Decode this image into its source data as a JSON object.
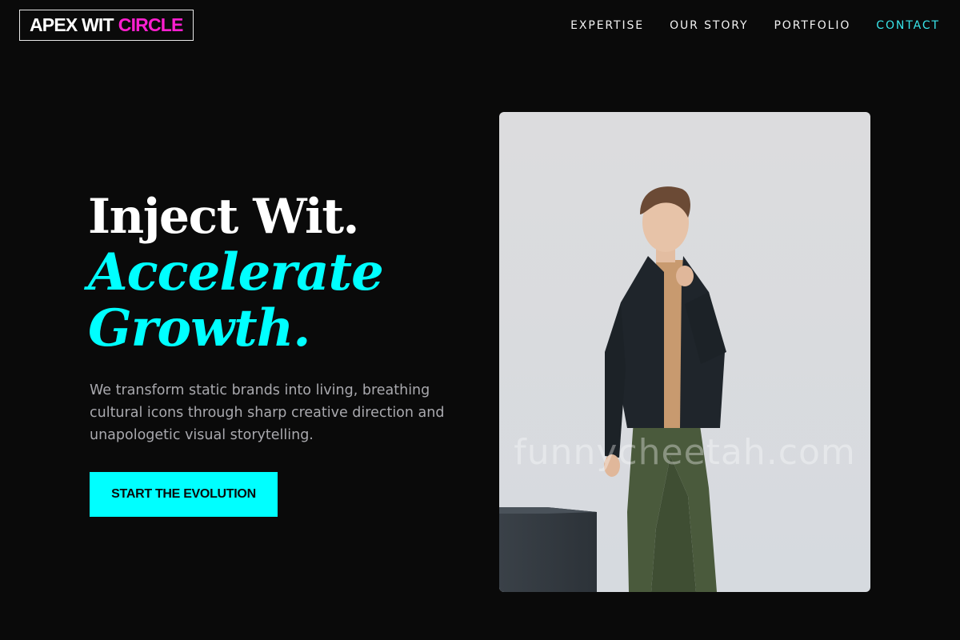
{
  "brand": {
    "word1": "APEX WIT",
    "word2": "CIRCLE",
    "accent_color": "#ff1fd0"
  },
  "nav": {
    "items": [
      {
        "label": "EXPERTISE"
      },
      {
        "label": "OUR STORY"
      },
      {
        "label": "PORTFOLIO"
      },
      {
        "label": "CONTACT",
        "active": true
      }
    ],
    "active_color": "#38e5ea"
  },
  "hero": {
    "line1": "Inject Wit.",
    "line2": "Accelerate",
    "line3": "Growth.",
    "subtitle": "We transform static brands into living, breathing cultural icons through sharp creative direction and unapologetic visual storytelling.",
    "cta_label": "START THE EVOLUTION",
    "accent_color": "#00ffff"
  },
  "image": {
    "watermark": "funnycheetah.com"
  },
  "colors": {
    "background": "#0a0a0a"
  }
}
